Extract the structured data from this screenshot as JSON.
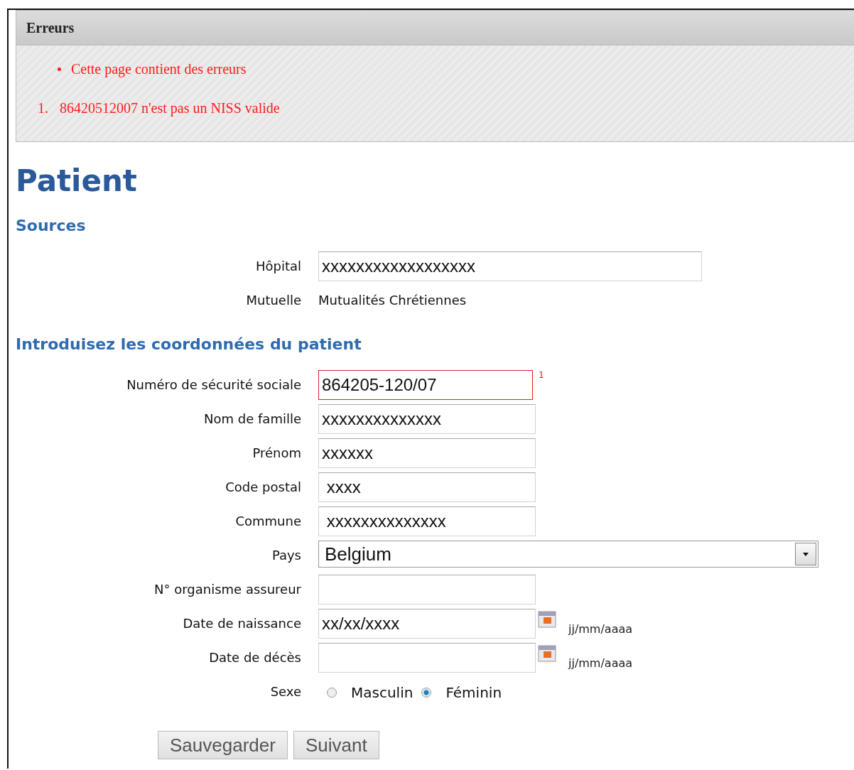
{
  "errors": {
    "title": "Erreurs",
    "bullets": [
      "Cette page contient des erreurs"
    ],
    "numbered": [
      {
        "number": "1.",
        "text": "86420512007 n'est pas un NISS valide"
      }
    ]
  },
  "page_title": "Patient",
  "sections": [
    {
      "heading": "Sources",
      "rows": [
        {
          "kind": "long",
          "label": "Hôpital",
          "value": "xxxxxxxxxxxxxxxxxx"
        },
        {
          "kind": "static",
          "label": "Mutuelle",
          "value": "Mutualités Chrétiennes"
        }
      ]
    },
    {
      "heading": "Introduisez les coordonnées du patient",
      "rows": [
        {
          "kind": "input",
          "label": "Numéro de sécurité sociale",
          "value": "864205-120/07",
          "error": true,
          "error_mark": "1"
        },
        {
          "kind": "input",
          "label": "Nom de famille",
          "value": "xxxxxxxxxxxxxx",
          "error": false
        },
        {
          "kind": "input",
          "label": "Prénom",
          "value": "xxxxxx",
          "error": false
        },
        {
          "kind": "input",
          "label": "Code postal",
          "value": " xxxx",
          "error": false
        },
        {
          "kind": "input",
          "label": "Commune",
          "value": " xxxxxxxxxxxxxx",
          "error": false
        },
        {
          "kind": "select",
          "label": "Pays",
          "value": "Belgium"
        },
        {
          "kind": "input",
          "label": "N° organisme assureur",
          "value": "",
          "error": false
        },
        {
          "kind": "date",
          "label": "Date de naissance",
          "value": "xx/xx/xxxx",
          "hint": "jj/mm/aaaa"
        },
        {
          "kind": "date",
          "label": "Date de décès",
          "value": "",
          "hint": "jj/mm/aaaa"
        },
        {
          "kind": "radio",
          "label": "Sexe",
          "options": [
            {
              "label": "Masculin",
              "selected": false
            },
            {
              "label": "Féminin",
              "selected": true
            }
          ]
        }
      ]
    }
  ],
  "buttons": [
    "Sauvegarder",
    "Suivant"
  ]
}
